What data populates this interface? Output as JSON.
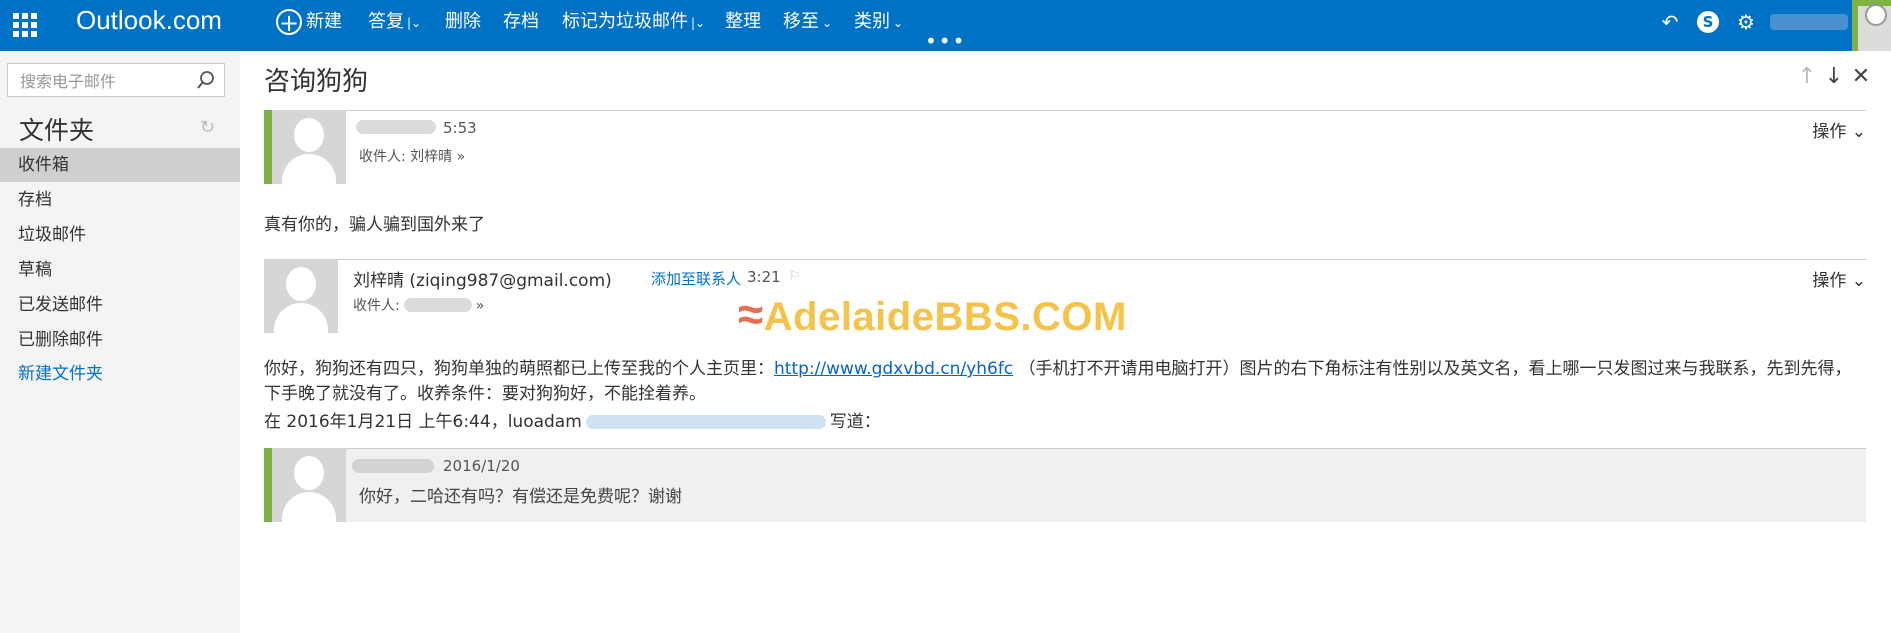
{
  "topbar": {
    "brand": "Outlook.com",
    "commands": {
      "new": "新建",
      "reply": "答复",
      "delete": "删除",
      "archive": "存档",
      "junk": "标记为垃圾邮件",
      "sweep": "整理",
      "move": "移至",
      "categories": "类别"
    },
    "more": "•••",
    "icons": [
      "apps-icon",
      "undo-icon",
      "skype-icon",
      "gear-icon",
      "user-avatar"
    ],
    "accent": "#0072c6"
  },
  "sidebar": {
    "search_placeholder": "搜索电子邮件",
    "folders_title": "文件夹",
    "folders": [
      {
        "label": "收件箱",
        "selected": true
      },
      {
        "label": "存档"
      },
      {
        "label": "垃圾邮件"
      },
      {
        "label": "草稿"
      },
      {
        "label": "已发送邮件"
      },
      {
        "label": "已删除邮件"
      }
    ],
    "new_folder": "新建文件夹"
  },
  "reading": {
    "subject": "咨询狗狗",
    "message1": {
      "time": "5:53",
      "recipient": "收件人: 刘梓晴",
      "actions": "操作",
      "body": "真有你的，骗人骗到国外来了"
    },
    "message2": {
      "sender": "刘梓晴 (ziqing987@gmail.com)",
      "add_contact": "添加至联系人",
      "time": "3:21",
      "recipient": "收件人:",
      "actions": "操作",
      "body_before_link": "你好，狗狗还有四只，狗狗单独的萌照都已上传至我的个人主页里：",
      "link": "http://www.gdxvbd.cn/yh6fc",
      "body_after_link": "（手机打不开请用电脑打开）图片的右下角标注有性别以及英文名，看上哪一只发图过来与我联系，先到先得，",
      "body_line2": "下手晚了就没有了。收养条件：要对狗狗好，不能拴着养。",
      "quote_intro_start": "在 2016年1月21日 上午6:44，luoadam",
      "quote_intro_end": "写道："
    },
    "quoted": {
      "date": "2016/1/20",
      "preview": "你好，二哈还有吗？有偿还是免费呢？谢谢"
    }
  },
  "watermark": {
    "text": "AdelaideBBS.COM",
    "color": "#f5c34a"
  }
}
